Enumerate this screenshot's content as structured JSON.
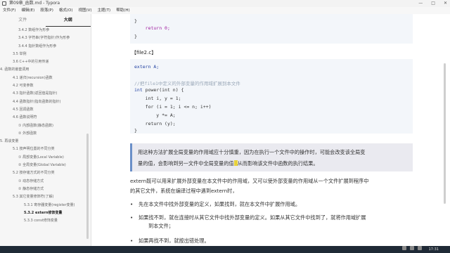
{
  "window": {
    "title": "第09章_函数.md - Typora"
  },
  "window_controls": [
    "—",
    "□",
    "✕"
  ],
  "menu": [
    "文件(F)",
    "编辑(E)",
    "段落(P)",
    "格式(O)",
    "视图(V)",
    "主题(T)",
    "帮助(H)"
  ],
  "sidebar": {
    "tabs": [
      "文件",
      "大纲"
    ],
    "active_tab": 1,
    "toc": [
      {
        "label": "3.4.2 数组作为形参",
        "level": 3
      },
      {
        "label": "3.4.3 字符串(字符指针)作为形参",
        "level": 3
      },
      {
        "label": "3.4.4 指针数组作为形参",
        "level": 3
      },
      {
        "label": "3.5 举例",
        "level": 2
      },
      {
        "label": "3.6 C++中的引用传递",
        "level": 2
      },
      {
        "label": "4. 函数的嵌套调用",
        "level": 1
      },
      {
        "label": "4.1 递归(recursion)函数",
        "level": 2
      },
      {
        "label": "4.2 可变参数",
        "level": 2
      },
      {
        "label": "4.3 指针函数(返回值是指针)",
        "level": 2
      },
      {
        "label": "4.4 函数指针(指向函数的指针)",
        "level": 2
      },
      {
        "label": "4.5 回调函数",
        "level": 2
      },
      {
        "label": "4.6 函数说明符",
        "level": 2
      },
      {
        "label": "① 内部函数(静态函数)",
        "level": 3
      },
      {
        "label": "② 外部函数",
        "level": 3
      },
      {
        "label": "5. 再谈变量",
        "level": 1
      },
      {
        "label": "5.1 按声明位置的不同分类",
        "level": 2
      },
      {
        "label": "① 局部变量(Local Variable)",
        "level": 3
      },
      {
        "label": "② 全局变量(Global Variable)",
        "level": 3
      },
      {
        "label": "5.2 按存储方式的不同分类",
        "level": 2
      },
      {
        "label": "① 动态存储方式",
        "level": 3
      },
      {
        "label": "② 静态存储方式",
        "level": 3
      },
      {
        "label": "5.3 其它变量修饰符(了解)",
        "level": 2
      },
      {
        "label": "5.3.1 寄存器变量(register变量)",
        "level": 4
      },
      {
        "label": "5.3.2 extern修饰变量",
        "level": 4,
        "active": true
      },
      {
        "label": "5.3.3 const修饰变量",
        "level": 4
      }
    ]
  },
  "editor": {
    "code_top": {
      "lines": [
        "}",
        "",
        "    return 0;",
        "}"
      ]
    },
    "file_heading": "【file2.c】",
    "code_main": {
      "line1": "extern A;",
      "comment": "//把file1中定义的外部变量的作用域扩展到本文件",
      "line3_type": "int",
      "line3_rest": " power(int n) {",
      "line4": "    int i, y = 1;",
      "line5": "    for (i = 1; i <= n; i++)",
      "line6": "        y *= A;",
      "line7": "    return (y);",
      "line8": "}"
    },
    "quote_line1": "用这种方法扩展全局变量的作用域应十分慎重，因为在执行一个文件中的操作时，可能会改变该全局变",
    "quote_line2a": "量的值，会影响到另一文件中全局变量的值",
    "quote_line2b": "从而影响该文件中函数的执行结果。",
    "para1": "extern既可以用来扩展外部变量在本文件中的作用域，又可以使外部变量的作用域从一个文件扩展到程序中",
    "para2": "的其它文件，系统在编译过程中遇到extern时，",
    "bullet1": "先在本文件中找外部变量的定义，如果找到，就在本文件中扩展作用域。",
    "bullet2a": "如果找不到，就在连接时从其它文件中找外部变量的定义。如果从其它文件中找到了，就将作用域扩展",
    "bullet2b": "到本文件；",
    "bullet3": "如果再找不到，就按出错处理。"
  },
  "statusbar": {
    "time": "17:31"
  },
  "colors": {
    "accent": "#6a8fc8",
    "code_bg": "#f3f6fa",
    "quote_bg": "#eaeaf0",
    "taskbar": "#1f2a36"
  }
}
